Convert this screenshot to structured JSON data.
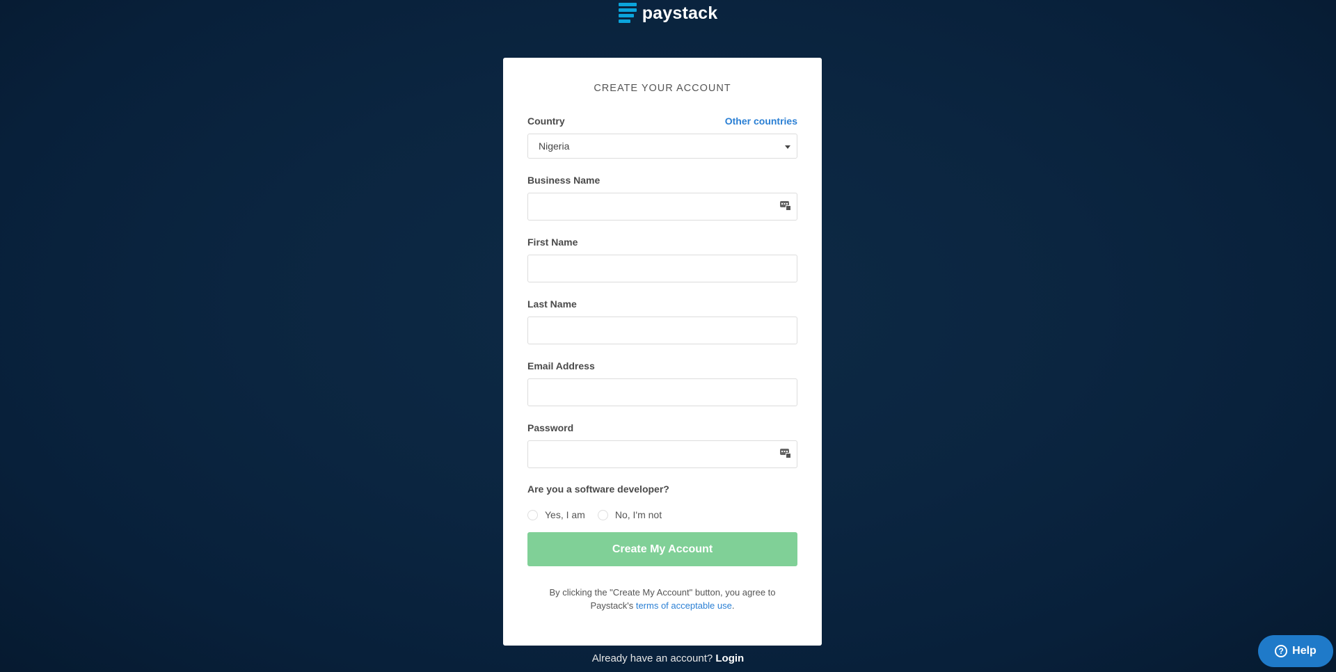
{
  "brand": {
    "name": "paystack",
    "accent": "#0ba4db"
  },
  "card": {
    "title": "CREATE YOUR ACCOUNT",
    "country": {
      "label": "Country",
      "other_link": "Other countries",
      "value": "Nigeria"
    },
    "fields": [
      {
        "label": "Business Name",
        "value": "",
        "placeholder": ""
      },
      {
        "label": "First Name",
        "value": "",
        "placeholder": ""
      },
      {
        "label": "Last Name",
        "value": "",
        "placeholder": ""
      },
      {
        "label": "Email Address",
        "value": "",
        "placeholder": ""
      },
      {
        "label": "Password",
        "value": "",
        "placeholder": ""
      }
    ],
    "developer_question": "Are you a software developer?",
    "radio_options": [
      "Yes, I am",
      "No, I'm not"
    ],
    "submit_label": "Create My Account",
    "submit_color": "#80d097",
    "terms_prefix": "By clicking the \"Create My Account\" button, you agree to Paystack's ",
    "terms_link": "terms of acceptable use",
    "terms_suffix": "."
  },
  "footer": {
    "prompt": "Already have an account?",
    "login_link": "Login"
  },
  "help": {
    "icon": "question-circle-icon",
    "label": "Help",
    "color": "#1f7ac9"
  }
}
